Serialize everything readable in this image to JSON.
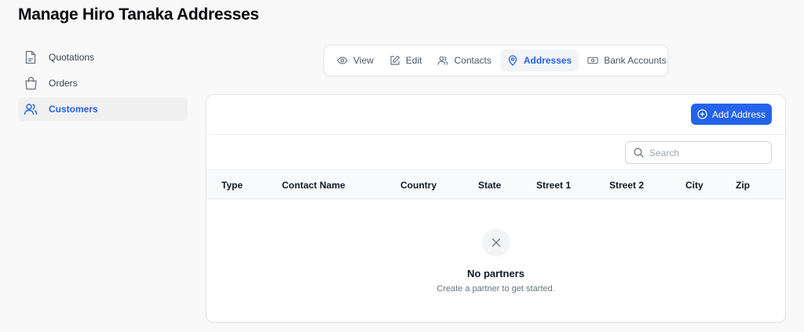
{
  "page": {
    "title": "Manage Hiro Tanaka Addresses"
  },
  "sidebar": {
    "items": [
      {
        "label": "Quotations",
        "icon": "document-icon"
      },
      {
        "label": "Orders",
        "icon": "shopping-bag-icon"
      },
      {
        "label": "Customers",
        "icon": "users-icon",
        "active": true
      }
    ]
  },
  "tabs": [
    {
      "label": "View",
      "icon": "eye-icon"
    },
    {
      "label": "Edit",
      "icon": "pencil-icon"
    },
    {
      "label": "Contacts",
      "icon": "users-icon"
    },
    {
      "label": "Addresses",
      "icon": "map-pin-icon",
      "active": true
    },
    {
      "label": "Bank Accounts",
      "icon": "banknote-icon"
    }
  ],
  "toolbar": {
    "add_label": "Add Address"
  },
  "search": {
    "placeholder": "Search",
    "value": ""
  },
  "table": {
    "columns": [
      "Type",
      "Contact Name",
      "Country",
      "State",
      "Street 1",
      "Street 2",
      "City",
      "Zip"
    ],
    "rows": []
  },
  "empty_state": {
    "title": "No partners",
    "subtitle": "Create a partner to get started."
  },
  "colors": {
    "accent": "#2563eb",
    "background": "#f9f9f9"
  }
}
